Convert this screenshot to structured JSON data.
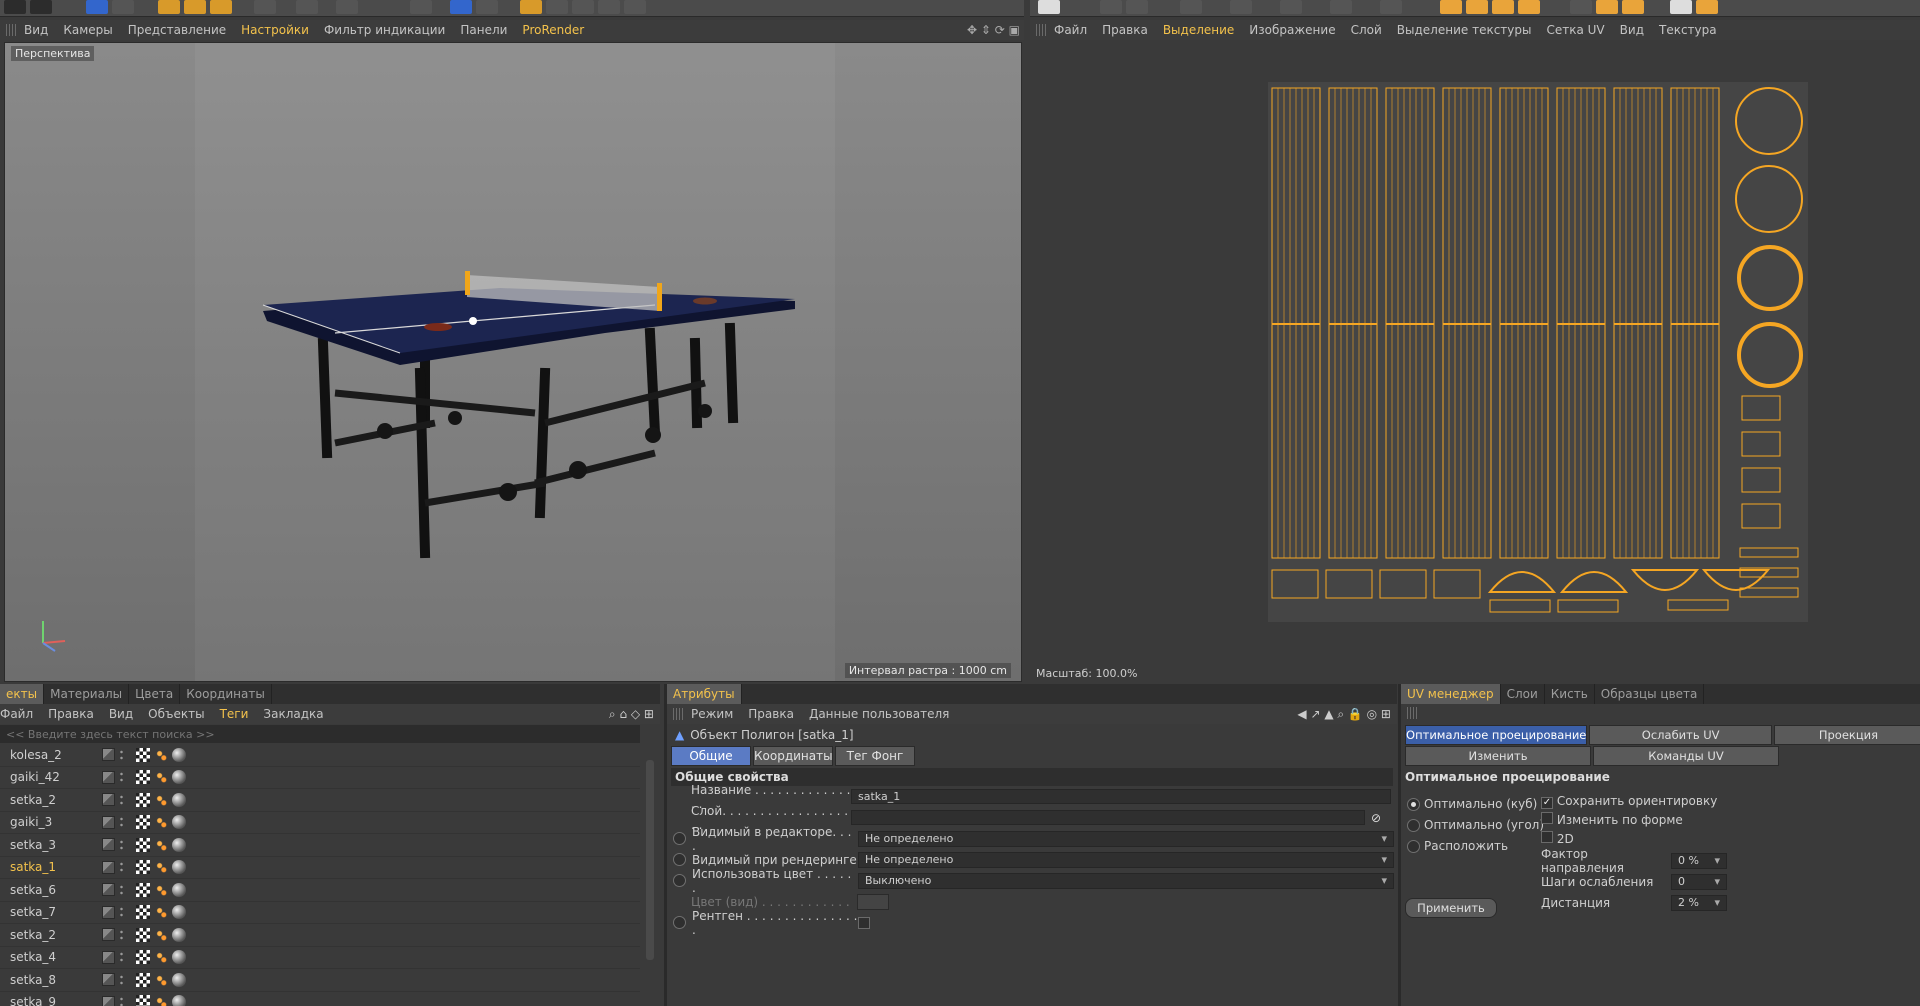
{
  "viewport_menu": {
    "items": [
      "Вид",
      "Камеры",
      "Представление",
      "Настройки",
      "Фильтр индикации",
      "Панели",
      "ProRender"
    ],
    "highlight": [
      3,
      6
    ]
  },
  "viewport": {
    "label": "Перспектива",
    "grid_interval": "Интервал растра : 1000 cm"
  },
  "uv_menu": {
    "items": [
      "Файл",
      "Правка",
      "Выделение",
      "Изображение",
      "Слой",
      "Выделение текстуры",
      "Сетка UV",
      "Вид",
      "Текстура"
    ],
    "highlight": [
      2
    ]
  },
  "uv": {
    "scale": "Масштаб: 100.0%"
  },
  "objects_panel": {
    "tabs": [
      "екты",
      "Материалы",
      "Цвета",
      "Координаты"
    ],
    "menu": [
      "Файл",
      "Правка",
      "Вид",
      "Объекты",
      "Теги",
      "Закладка"
    ],
    "menu_highlight": [
      4
    ],
    "search_placeholder": "<< Введите здесь текст поиска >>",
    "rows": [
      {
        "name": "kolesa_2"
      },
      {
        "name": "gaiki_42"
      },
      {
        "name": "setka_2"
      },
      {
        "name": "gaiki_3"
      },
      {
        "name": "setka_3"
      },
      {
        "name": "satka_1",
        "active": true
      },
      {
        "name": "setka_6"
      },
      {
        "name": "setka_7"
      },
      {
        "name": "setka_2"
      },
      {
        "name": "setka_4"
      },
      {
        "name": "setka_8"
      },
      {
        "name": "setka_9"
      }
    ]
  },
  "attributes_panel": {
    "tab": "Атрибуты",
    "menu": [
      "Режим",
      "Правка",
      "Данные пользователя"
    ],
    "object_title": "Объект Полигон [satka_1]",
    "subtabs": [
      "Общие",
      "Координаты",
      "Тег Фонг"
    ],
    "section": "Общие свойства",
    "fields": {
      "name_label": "Название . . . . . . . . . . . . . . .",
      "name_value": "satka_1",
      "layer_label": "Слой. . . . . . . . . . . . . . . . . . .",
      "vis_editor_label": "Видимый в редакторе. . . .",
      "vis_editor_value": "Не определено",
      "vis_render_label": "Видимый при рендеринге",
      "vis_render_value": "Не определено",
      "use_color_label": "Использовать цвет . . . . . .",
      "use_color_value": "Выключено",
      "color_label": "Цвет (вид) . . . . . . . . . . . .",
      "xray_label": "Рентген . . . . . . . . . . . . . . . ."
    }
  },
  "uv_manager": {
    "tabs": [
      "UV менеджер",
      "Слои",
      "Кисть",
      "Образцы цвета"
    ],
    "buttons_row1": [
      "Оптимальное проецирование",
      "Ослабить UV",
      "Проекция"
    ],
    "buttons_row2": [
      "Изменить",
      "Команды UV"
    ],
    "section": "Оптимальное проецирование",
    "radios": [
      "Оптимально (куб)",
      "Оптимально (угол)",
      "Расположить"
    ],
    "checks": [
      {
        "label": "Сохранить ориентировку",
        "checked": true
      },
      {
        "label": "Изменить по форме",
        "checked": false
      },
      {
        "label": "2D",
        "checked": false
      }
    ],
    "params": [
      {
        "label": "Фактор направления",
        "value": "0 %"
      },
      {
        "label": "Шаги ослабления",
        "value": "0"
      },
      {
        "label": "Дистанция",
        "value": "2 %"
      }
    ],
    "apply": "Применить"
  },
  "colors": {
    "accent": "#f3c24c",
    "uv_wire": "#f5a623",
    "table_top": "#1c2550"
  }
}
